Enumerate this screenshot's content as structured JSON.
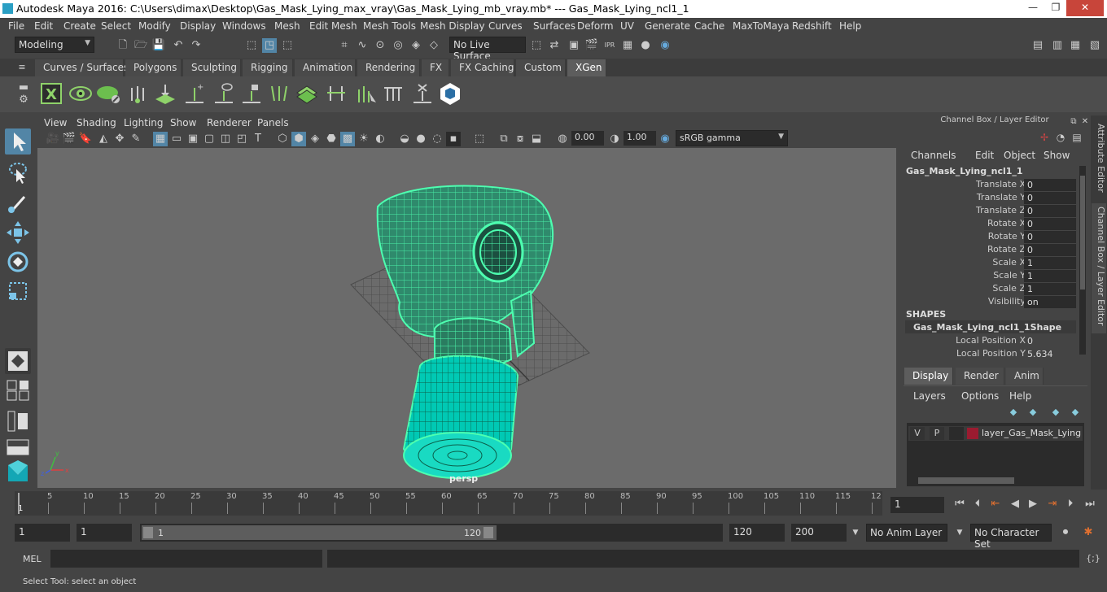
{
  "window": {
    "title": "Autodesk Maya 2016: C:\\Users\\dimax\\Desktop\\Gas_Mask_Lying_max_vray\\Gas_Mask_Lying_mb_vray.mb*   ---   Gas_Mask_Lying_ncl1_1",
    "minimize": "—",
    "restore": "❐",
    "close": "✕"
  },
  "menubar": [
    "File",
    "Edit",
    "Create",
    "Select",
    "Modify",
    "Display",
    "Windows",
    "Mesh",
    "Edit Mesh",
    "Mesh Tools",
    "Mesh Display",
    "Curves",
    "Surfaces",
    "Deform",
    "UV",
    "Generate",
    "Cache",
    "MaxToMaya",
    "Redshift",
    "Help"
  ],
  "status": {
    "mode": "Modeling",
    "live_surface": "No Live Surface"
  },
  "shelf_tabs": [
    "Curves / Surfaces",
    "Polygons",
    "Sculpting",
    "Rigging",
    "Animation",
    "Rendering",
    "FX",
    "FX Caching",
    "Custom",
    "XGen"
  ],
  "active_shelf_tab": "XGen",
  "viewport": {
    "menus": [
      "View",
      "Shading",
      "Lighting",
      "Show",
      "Renderer",
      "Panels"
    ],
    "exposure": "0.00",
    "gamma": "1.00",
    "color_space": "sRGB gamma",
    "camera_label": "persp",
    "wire_color": "#4dffb0",
    "bg_color": "#6b6b6b"
  },
  "channel_box": {
    "header": "Channel Box / Layer Editor",
    "menus": [
      "Channels",
      "Edit",
      "Object",
      "Show"
    ],
    "object_name": "Gas_Mask_Lying_ncl1_1",
    "attributes": [
      {
        "label": "Translate X",
        "value": "0"
      },
      {
        "label": "Translate Y",
        "value": "0"
      },
      {
        "label": "Translate Z",
        "value": "0"
      },
      {
        "label": "Rotate X",
        "value": "0"
      },
      {
        "label": "Rotate Y",
        "value": "0"
      },
      {
        "label": "Rotate Z",
        "value": "0"
      },
      {
        "label": "Scale X",
        "value": "1"
      },
      {
        "label": "Scale Y",
        "value": "1"
      },
      {
        "label": "Scale Z",
        "value": "1"
      },
      {
        "label": "Visibility",
        "value": "on"
      }
    ],
    "shapes_heading": "SHAPES",
    "shape_name": "Gas_Mask_Lying_ncl1_1Shape",
    "shape_attributes": [
      {
        "label": "Local Position X",
        "value": "0"
      },
      {
        "label": "Local Position Y",
        "value": "5.634"
      }
    ]
  },
  "side_tabs": [
    "Attribute Editor",
    "Channel Box / Layer Editor"
  ],
  "layer_editor": {
    "tabs": [
      "Display",
      "Render",
      "Anim"
    ],
    "active_tab": "Display",
    "menus": [
      "Layers",
      "Options",
      "Help"
    ],
    "layer": {
      "v": "V",
      "p": "P",
      "name": "layer_Gas_Mask_Lying",
      "color": "#9b1b30"
    }
  },
  "timeline": {
    "ticks": [
      "5",
      "10",
      "15",
      "20",
      "25",
      "30",
      "35",
      "40",
      "45",
      "50",
      "55",
      "60",
      "65",
      "70",
      "75",
      "80",
      "85",
      "90",
      "95",
      "100",
      "105",
      "110",
      "115",
      "12"
    ],
    "start_marker": "1",
    "current_frame": "1"
  },
  "range": {
    "start": "1",
    "playback_start": "1",
    "slider_start": "1",
    "slider_end": "120",
    "playback_end": "120",
    "end": "200",
    "anim_layer": "No Anim Layer",
    "character_set": "No Character Set"
  },
  "cmdline": {
    "label": "MEL"
  },
  "helpline": {
    "text": "Select Tool: select an object"
  }
}
